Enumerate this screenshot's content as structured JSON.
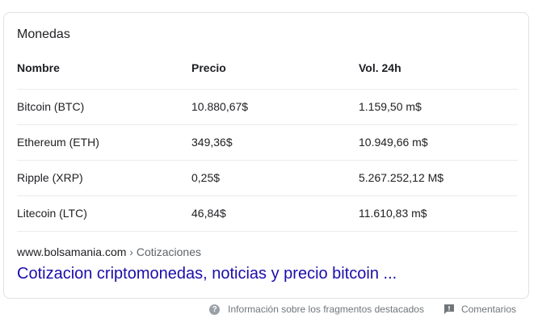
{
  "card": {
    "title": "Monedas",
    "table": {
      "columns": [
        "Nombre",
        "Precio",
        "Vol. 24h"
      ],
      "rows": [
        [
          "Bitcoin (BTC)",
          "10.880,67$",
          "1.159,50 m$"
        ],
        [
          "Ethereum (ETH)",
          "349,36$",
          "10.949,66 m$"
        ],
        [
          "Ripple (XRP)",
          "0,25$",
          "5.267.252,12 M$"
        ],
        [
          "Litecoin (LTC)",
          "46,84$",
          "11.610,83 m$"
        ]
      ]
    },
    "source_domain": "www.bolsamania.com",
    "source_crumb": "› Cotizaciones",
    "result_title": "Cotizacion criptomonedas, noticias y precio bitcoin ..."
  },
  "footer": {
    "help_icon": "question-circle-icon",
    "help_glyph": "?",
    "help_label": "Información sobre los fragmentos destacados",
    "feedback_icon": "feedback-flag-icon",
    "feedback_label": "Comentarios"
  },
  "colors": {
    "link": "#1a0dab",
    "border": "#dfe1e5",
    "muted": "#70757a"
  }
}
